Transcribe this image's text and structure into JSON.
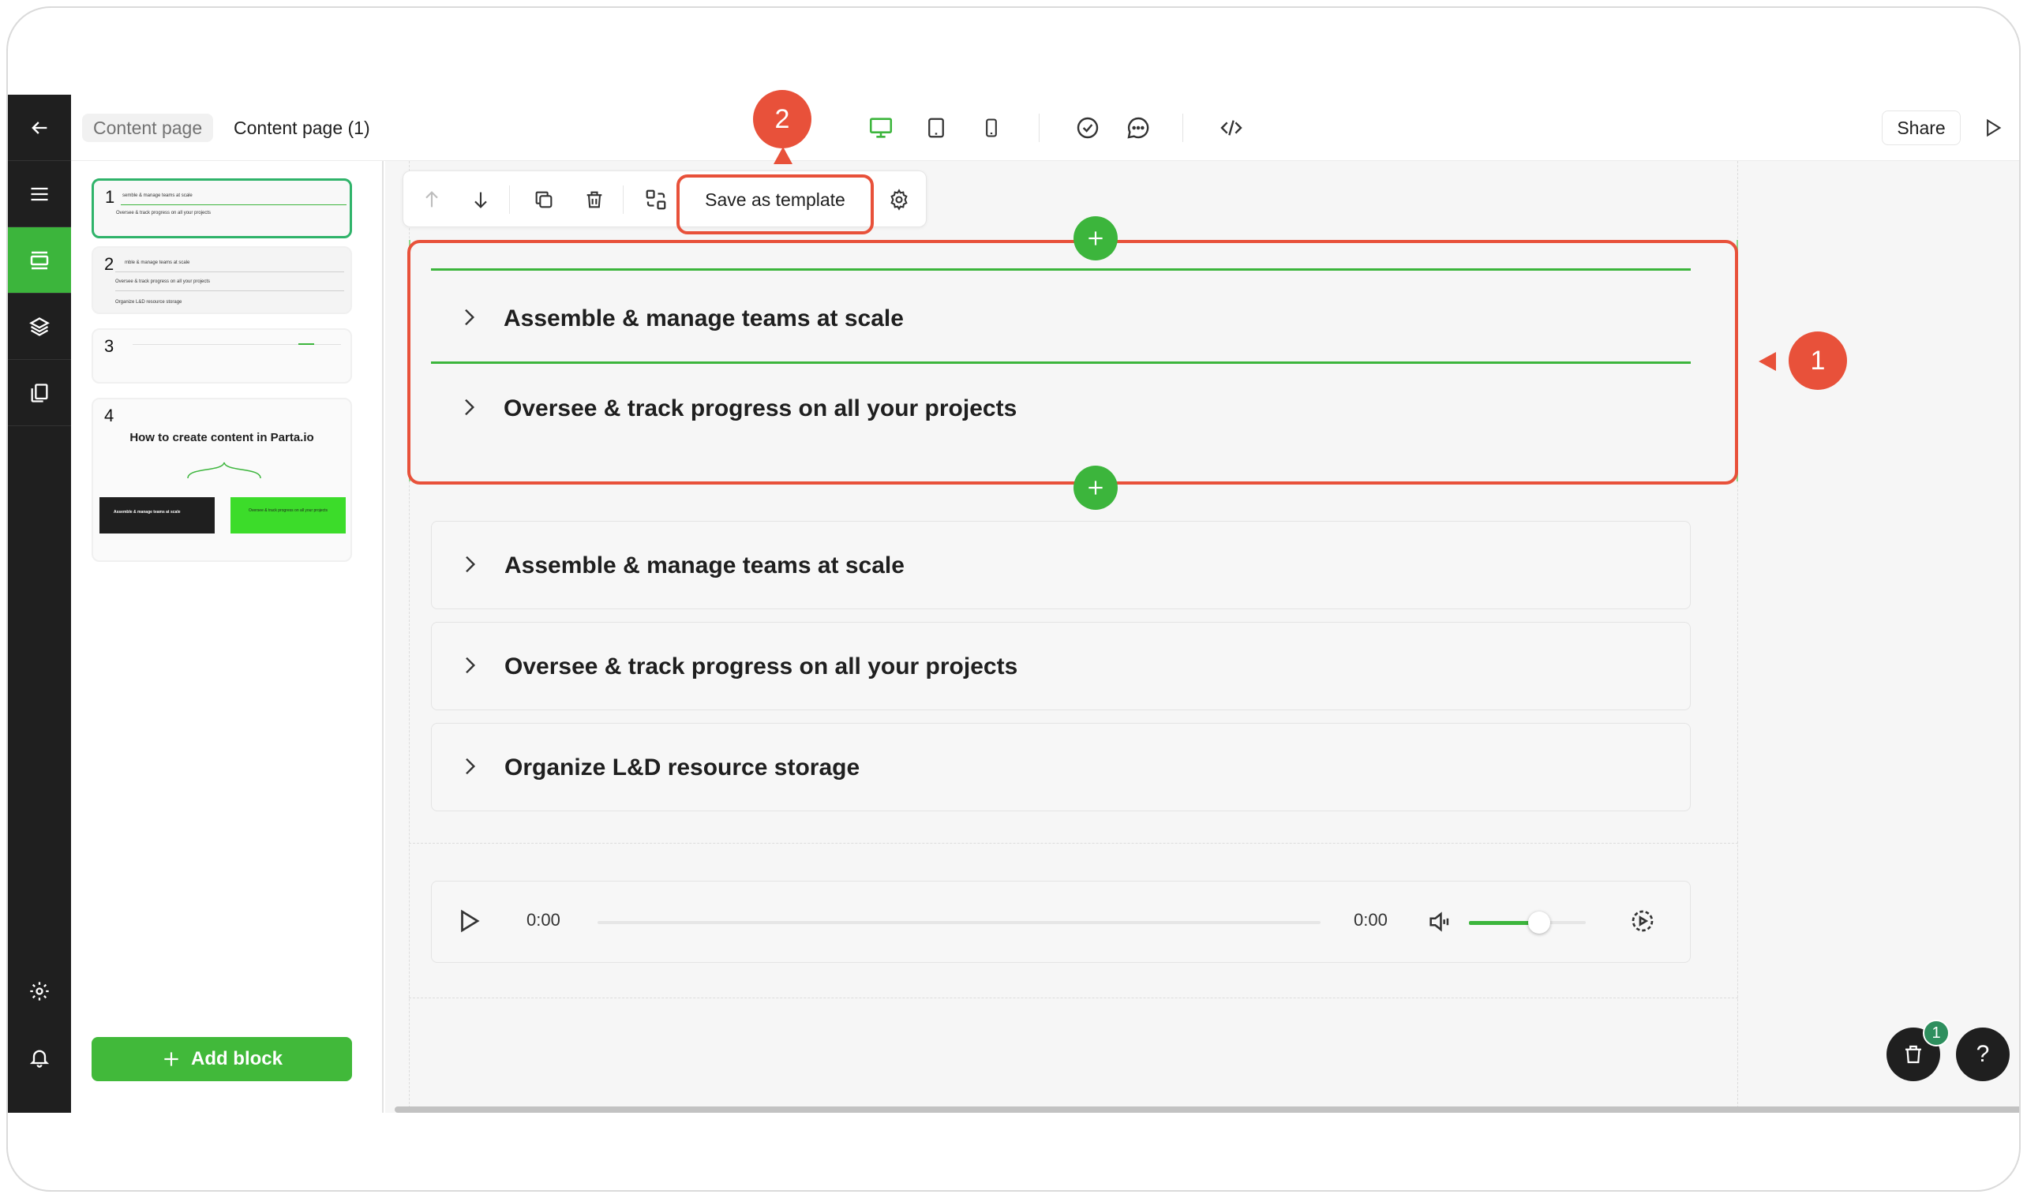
{
  "header": {
    "breadcrumb_parent": "Content page",
    "page_title": "Content page (1)",
    "share_label": "Share"
  },
  "slides": [
    {
      "number": "1",
      "lines": [
        "semble & manage teams at scale",
        "Oversee & track progress on all your projects"
      ]
    },
    {
      "number": "2",
      "lines": [
        "mble & manage teams at scale",
        "Oversee & track progress on all your projects",
        "Organize L&D resource storage"
      ]
    },
    {
      "number": "3"
    },
    {
      "number": "4",
      "title": "How to create content in Parta.io",
      "box_left": "Assemble & manage teams at scale",
      "box_right": "Oversee & track progress on all your projects"
    }
  ],
  "sidebar": {
    "add_block_label": "Add block"
  },
  "toolbar": {
    "save_template_label": "Save as template"
  },
  "callouts": {
    "one": "1",
    "two": "2"
  },
  "selected_block": {
    "items": [
      "Assemble & manage teams at scale",
      "Oversee & track progress on all your projects"
    ]
  },
  "accordion": {
    "items": [
      "Assemble & manage teams at scale",
      "Oversee & track progress on all your projects",
      "Organize L&D resource storage"
    ]
  },
  "audio": {
    "current_time": "0:00",
    "duration": "0:00",
    "progress": 0,
    "volume": 0.6
  },
  "floating": {
    "cart_badge": "1",
    "help_label": "?"
  },
  "colors": {
    "accent_green": "#3cb53c",
    "callout_red": "#e8513a",
    "rail_dark": "#1f1f1f"
  }
}
